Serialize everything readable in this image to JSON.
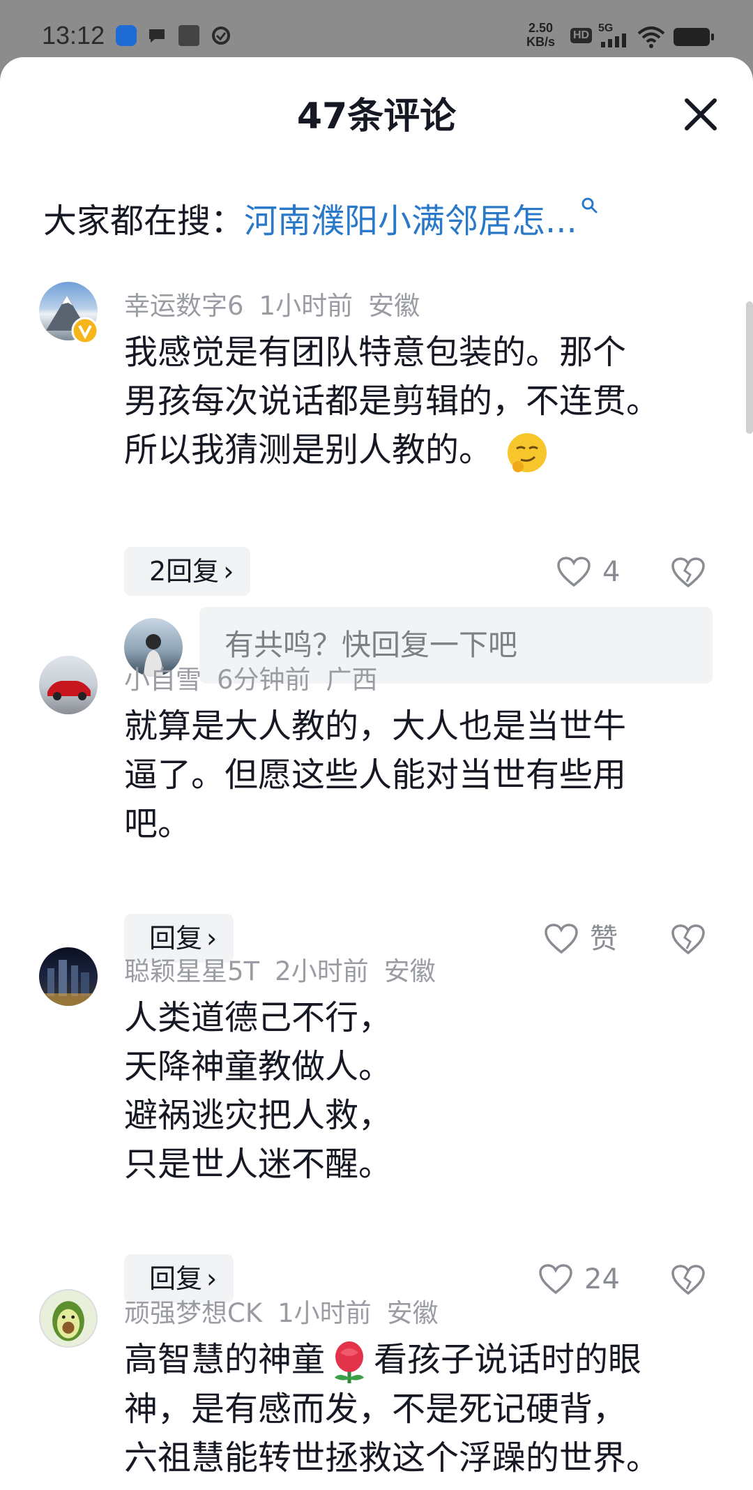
{
  "status_bar": {
    "time": "13:12",
    "net_speed_value": "2.50",
    "net_speed_unit": "KB/s",
    "hd_badge": "HD",
    "signal": "5G",
    "icons": [
      "app-icon",
      "chat-bubble-icon",
      "news-icon",
      "check-circle-icon",
      "wifi-icon",
      "battery-icon"
    ]
  },
  "header": {
    "title": "47条评论",
    "close_icon": "close-icon"
  },
  "hot_search": {
    "label": "大家都在搜：",
    "query": "河南濮阳小满邻居怎...",
    "icon": "search-icon"
  },
  "comments": [
    {
      "user": "幸运数字6",
      "time": "1小时前",
      "location": "安徽",
      "verified": true,
      "lines": [
        "我感觉是有团队特意包装的。那个",
        "男孩每次说话都是剪辑的，不连贯。",
        "所以我猜测是别人教的。"
      ],
      "emoji": "smirk-emoji",
      "reply_label": "2回复",
      "likes": "4"
    },
    {
      "user": "小自雪",
      "time": "6分钟前",
      "location": "广西",
      "lines": [
        "就算是大人教的，大人也是当世牛",
        "逼了。但愿这些人能对当世有些用",
        "吧。"
      ],
      "reply_label": "回复",
      "likes": "赞"
    },
    {
      "user": "聪颖星星5T",
      "time": "2小时前",
      "location": "安徽",
      "lines": [
        "人类道德己不行，",
        "天降神童教做人。",
        "避祸逃灾把人救，",
        "只是世人迷不醒。"
      ],
      "reply_label": "回复",
      "likes": "24"
    },
    {
      "user": "顽强梦想CK",
      "time": "1小时前",
      "location": "安徽",
      "lines": [
        "高智慧的神童",
        "看孩子说话时的眼",
        "神，是有感而发，不是死记硬背，",
        "六祖慧能转世拯救这个浮躁的世界。"
      ],
      "emoji": "rose-emoji"
    }
  ],
  "reply_box": {
    "placeholder": "有共鸣？快回复一下吧"
  },
  "colors": {
    "link": "#2a79c8",
    "meta": "#9a9ca3",
    "chip_bg": "#f2f3f5",
    "status_bar_bg": "#8c8c8c"
  }
}
